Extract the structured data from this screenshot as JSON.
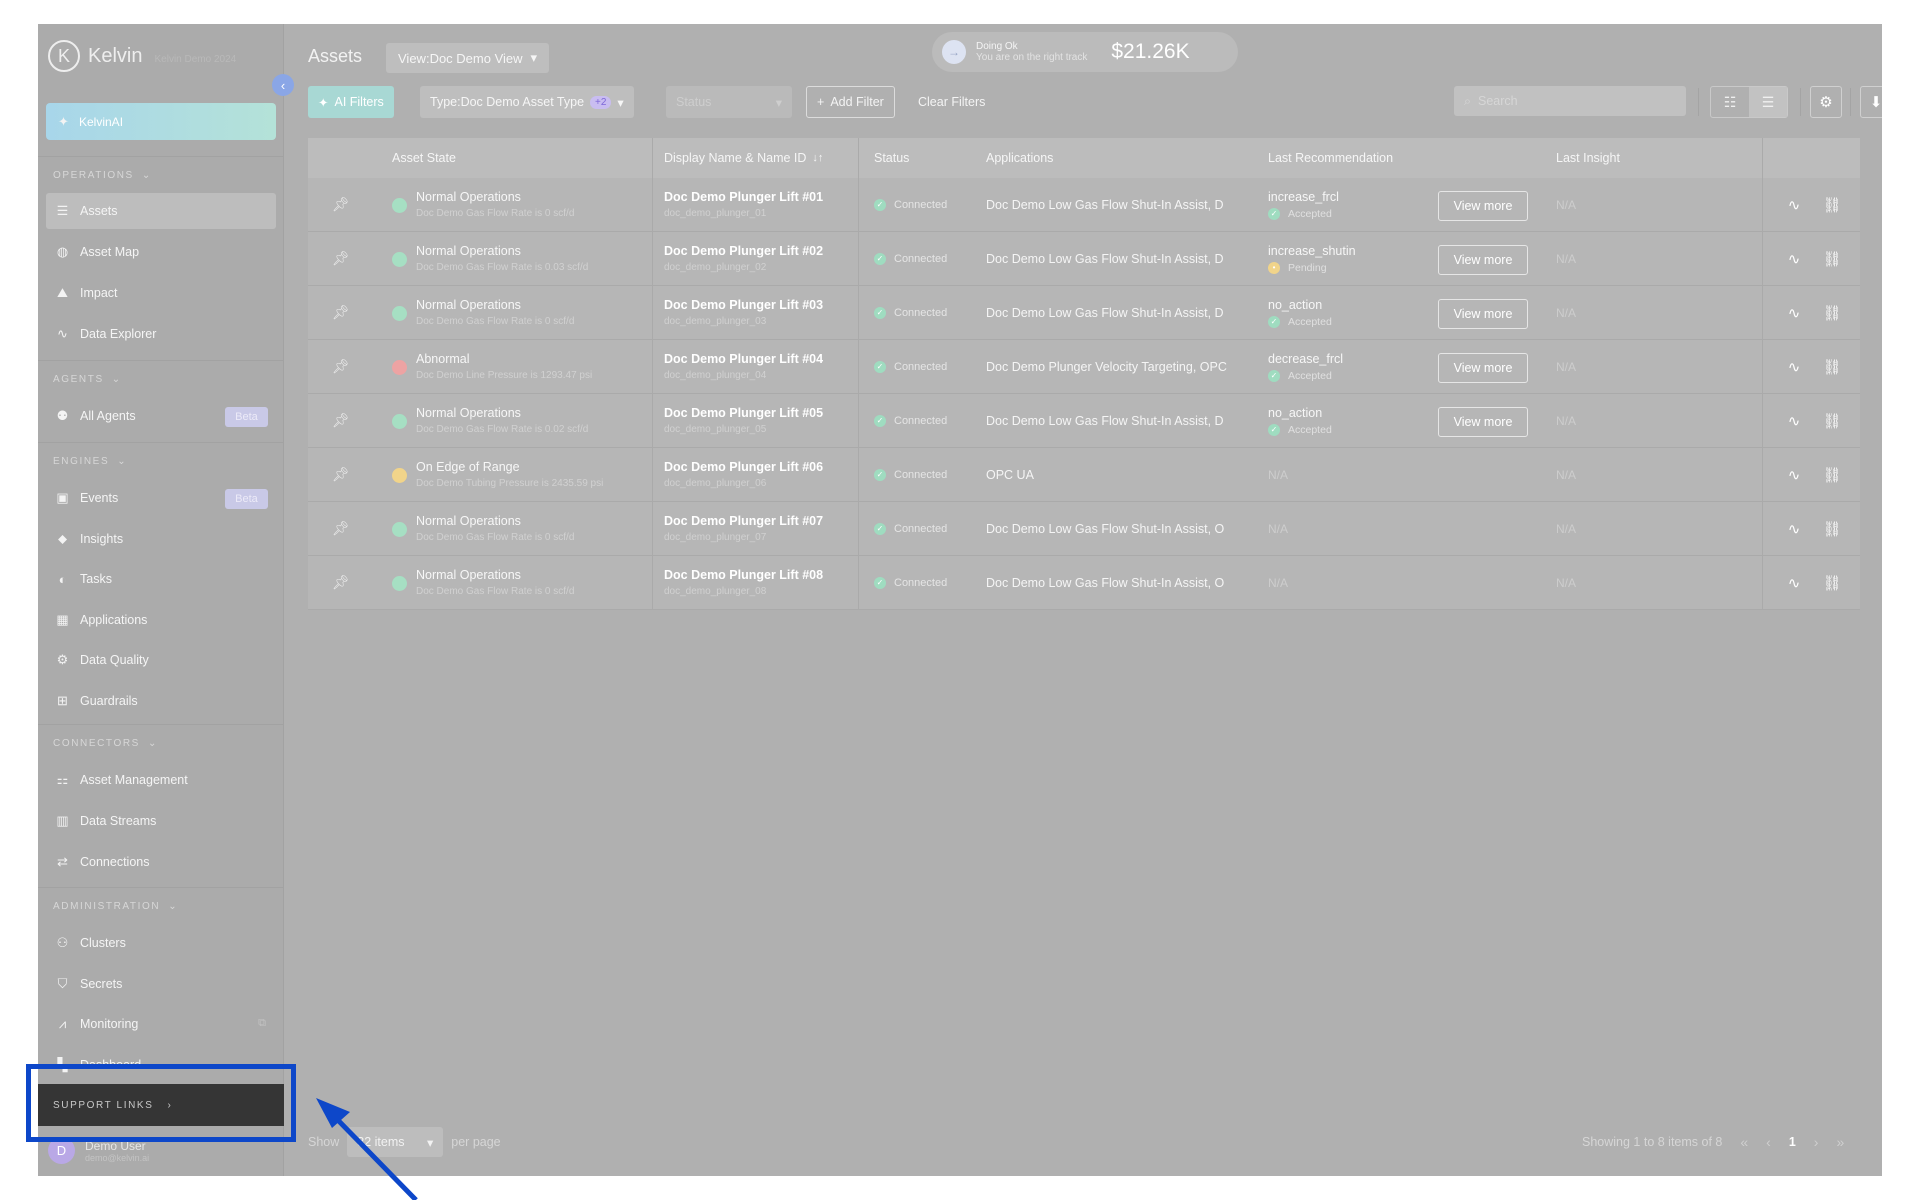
{
  "brand": {
    "name": "Kelvin",
    "logo_letter": "K",
    "subtitle": "Kelvin Demo 2024"
  },
  "sidebar": {
    "ai_button": "KelvinAI",
    "sections": {
      "operations": "OPERATIONS",
      "agents": "AGENTS",
      "engines": "ENGINES",
      "connectors": "CONNECTORS",
      "administration": "ADMINISTRATION"
    },
    "items": {
      "assets": "Assets",
      "asset_map": "Asset Map",
      "impact": "Impact",
      "data_explorer": "Data Explorer",
      "all_agents": "All Agents",
      "events": "Events",
      "insights": "Insights",
      "tasks": "Tasks",
      "applications": "Applications",
      "data_quality": "Data Quality",
      "guardrails": "Guardrails",
      "asset_management": "Asset Management",
      "data_streams": "Data Streams",
      "connections": "Connections",
      "clusters": "Clusters",
      "secrets": "Secrets",
      "monitoring": "Monitoring",
      "dashboard": "Dashboard"
    },
    "beta_label": "Beta",
    "support_links": "SUPPORT LINKS",
    "user": {
      "initial": "D",
      "name": "Demo User",
      "email": "demo@kelvin.ai"
    }
  },
  "header": {
    "title": "Assets",
    "view_prefix": "View:",
    "view_value": "Doc Demo View",
    "status_title": "Doing Ok",
    "status_sub": "You are on the right track",
    "amount": "$21.26K"
  },
  "filters": {
    "ai_filters": "AI Filters",
    "type_prefix": "Type:",
    "type_value": "Doc Demo Asset Type",
    "type_extra": "+2",
    "status_placeholder": "Status",
    "add_filter": "Add Filter",
    "clear_filters": "Clear Filters",
    "search_placeholder": "Search"
  },
  "table": {
    "headers": {
      "asset_state": "Asset State",
      "display_name": "Display Name & Name ID",
      "status": "Status",
      "applications": "Applications",
      "last_recommendation": "Last Recommendation",
      "last_insight": "Last Insight"
    },
    "view_more": "View more",
    "rows": [
      {
        "state": "Normal Operations",
        "state_color": "#a6dfc3",
        "state_detail": "Doc Demo Gas Flow Rate is 0 scf/d",
        "name": "Doc Demo Plunger Lift #01",
        "id": "doc_demo_plunger_01",
        "status": "Connected",
        "apps": "Doc Demo Low Gas Flow Shut-In Assist, D",
        "rec": "increase_frcl",
        "rec_status": "Accepted",
        "rec_pending": false,
        "insight": "N/A"
      },
      {
        "state": "Normal Operations",
        "state_color": "#a6dfc3",
        "state_detail": "Doc Demo Gas Flow Rate is 0.03 scf/d",
        "name": "Doc Demo Plunger Lift #02",
        "id": "doc_demo_plunger_02",
        "status": "Connected",
        "apps": "Doc Demo Low Gas Flow Shut-In Assist, D",
        "rec": "increase_shutin",
        "rec_status": "Pending",
        "rec_pending": true,
        "insight": "N/A"
      },
      {
        "state": "Normal Operations",
        "state_color": "#a6dfc3",
        "state_detail": "Doc Demo Gas Flow Rate is 0 scf/d",
        "name": "Doc Demo Plunger Lift #03",
        "id": "doc_demo_plunger_03",
        "status": "Connected",
        "apps": "Doc Demo Low Gas Flow Shut-In Assist, D",
        "rec": "no_action",
        "rec_status": "Accepted",
        "rec_pending": false,
        "insight": "N/A"
      },
      {
        "state": "Abnormal",
        "state_color": "#eda3a3",
        "state_detail": "Doc Demo Line Pressure is 1293.47 psi",
        "name": "Doc Demo Plunger Lift #04",
        "id": "doc_demo_plunger_04",
        "status": "Connected",
        "apps": "Doc Demo Plunger Velocity Targeting, OPC",
        "rec": "decrease_frcl",
        "rec_status": "Accepted",
        "rec_pending": false,
        "insight": "N/A"
      },
      {
        "state": "Normal Operations",
        "state_color": "#a6dfc3",
        "state_detail": "Doc Demo Gas Flow Rate is 0.02 scf/d",
        "name": "Doc Demo Plunger Lift #05",
        "id": "doc_demo_plunger_05",
        "status": "Connected",
        "apps": "Doc Demo Low Gas Flow Shut-In Assist, D",
        "rec": "no_action",
        "rec_status": "Accepted",
        "rec_pending": false,
        "insight": "N/A"
      },
      {
        "state": "On Edge of Range",
        "state_color": "#f1d48a",
        "state_detail": "Doc Demo Tubing Pressure is 2435.59 psi",
        "name": "Doc Demo Plunger Lift #06",
        "id": "doc_demo_plunger_06",
        "status": "Connected",
        "apps": "OPC UA",
        "rec": "N/A",
        "rec_status": "",
        "rec_pending": false,
        "insight": "N/A"
      },
      {
        "state": "Normal Operations",
        "state_color": "#a6dfc3",
        "state_detail": "Doc Demo Gas Flow Rate is 0 scf/d",
        "name": "Doc Demo Plunger Lift #07",
        "id": "doc_demo_plunger_07",
        "status": "Connected",
        "apps": "Doc Demo Low Gas Flow Shut-In Assist, O",
        "rec": "N/A",
        "rec_status": "",
        "rec_pending": false,
        "insight": "N/A"
      },
      {
        "state": "Normal Operations",
        "state_color": "#a6dfc3",
        "state_detail": "Doc Demo Gas Flow Rate is 0 scf/d",
        "name": "Doc Demo Plunger Lift #08",
        "id": "doc_demo_plunger_08",
        "status": "Connected",
        "apps": "Doc Demo Low Gas Flow Shut-In Assist, O",
        "rec": "N/A",
        "rec_status": "",
        "rec_pending": false,
        "insight": "N/A"
      }
    ]
  },
  "footer": {
    "show_label": "Show",
    "per_page_value": "32 items",
    "per_page_label": "per page",
    "showing": "Showing 1 to 8 items of 8",
    "current_page": "1"
  },
  "colors": {
    "highlight": "#0d47c9",
    "accent_ai": "#a8d8d4",
    "connected": "#9fdcc0"
  }
}
